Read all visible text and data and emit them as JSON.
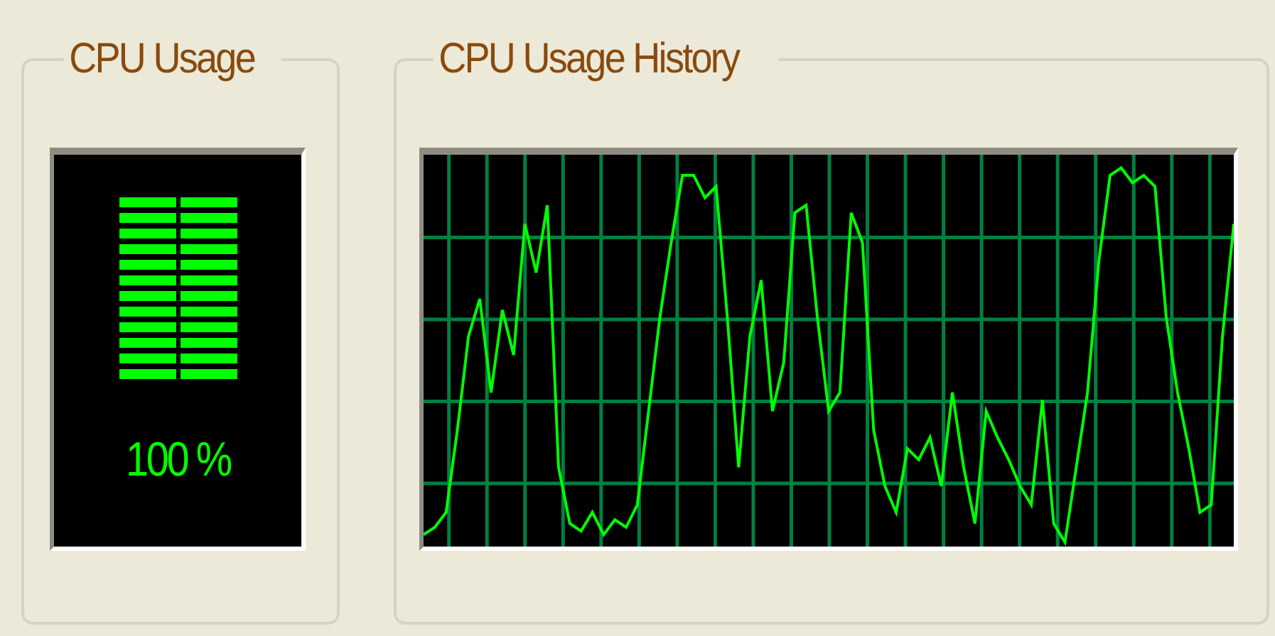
{
  "cpu_usage": {
    "title": "CPU Usage",
    "level": 1,
    "reading": "100 %"
  },
  "cpu_usage_history": {
    "title": "CPU Usage History"
  }
}
